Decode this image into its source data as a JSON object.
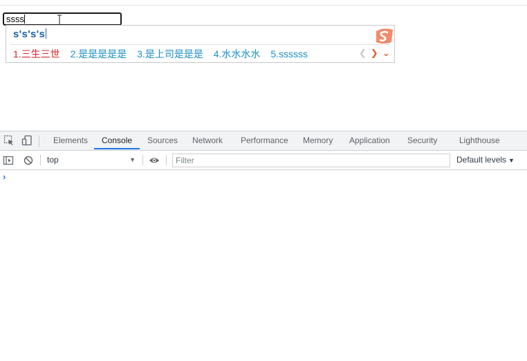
{
  "page": {
    "input_value": "ssss"
  },
  "ime": {
    "composition": "s's's's",
    "candidates": [
      {
        "label": "1.三生三世",
        "active": true
      },
      {
        "label": "2.是是是是是",
        "active": false
      },
      {
        "label": "3.是上司是是是",
        "active": false
      },
      {
        "label": "4.水水水水",
        "active": false
      },
      {
        "label": "5.ssssss",
        "active": false
      }
    ],
    "logo_icon": "sogou-logo-icon",
    "accent_color": "#e25b2c"
  },
  "devtools": {
    "tabs": [
      {
        "label": "Elements",
        "active": false
      },
      {
        "label": "Console",
        "active": true
      },
      {
        "label": "Sources",
        "active": false
      },
      {
        "label": "Network",
        "active": false
      },
      {
        "label": "Performance",
        "active": false
      },
      {
        "label": "Memory",
        "active": false
      },
      {
        "label": "Application",
        "active": false
      },
      {
        "label": "Security",
        "active": false
      },
      {
        "label": "Lighthouse",
        "active": false
      }
    ],
    "toolbar": {
      "context": "top",
      "filter_placeholder": "Filter",
      "levels_label": "Default levels"
    },
    "accent_color": "#1a73e8"
  }
}
